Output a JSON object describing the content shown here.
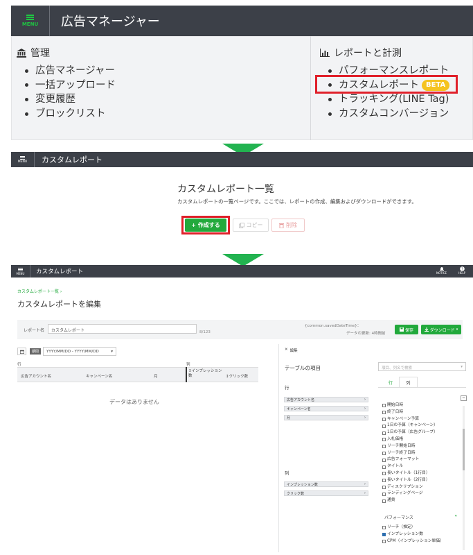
{
  "panel1": {
    "menu_label": "MENU",
    "title": "広告マネージャー",
    "admin": {
      "heading": "管理",
      "items": [
        "広告マネージャー",
        "一括アップロード",
        "変更履歴",
        "ブロックリスト"
      ]
    },
    "reports": {
      "heading": "レポートと計測",
      "items": [
        "パフォーマンスレポート",
        "カスタムレポート",
        "トラッキング(LINE Tag)",
        "カスタムコンバージョン"
      ],
      "beta_label": "BETA"
    }
  },
  "panel2": {
    "menu_label": "MENU",
    "header_title": "カスタムレポート",
    "page_title": "カスタムレポート一覧",
    "description": "カスタムレポートの一覧ページです。ここでは、レポートの作成、編集およびダウンロードができます。",
    "create_btn": "+ 作成する",
    "copy_btn": "コピー",
    "delete_btn": "削除"
  },
  "panel3": {
    "menu_label": "MENU",
    "header_title": "カスタムレポート",
    "notice_label": "NOTICE",
    "help_label": "HELP",
    "breadcrumb": "カスタムレポート一覧 ›",
    "page_title": "カスタムレポートを編集",
    "report_name_label": "レポート名",
    "report_name_value": "カスタムレポート",
    "char_count": "8/123",
    "saved_time": "{common.savedDateTime}：",
    "data_update": "データの更新: 4時間前",
    "save_btn": "保存",
    "download_btn": "ダウンロード",
    "period_label": "期間",
    "date_placeholder": "YYYY/MM/DD - YYYY/MM/DD",
    "rows_label": "行",
    "cols_label": "列",
    "table_cols": [
      "広告アカウント名",
      "キャンペーン名",
      "月",
      "インプレッション数",
      "クリック数"
    ],
    "no_data": "データはありません",
    "edit_label": "編集",
    "table_items_label": "テーブルの項目",
    "search_placeholder": "項目、列名で検索",
    "row_section": "行",
    "row_chips": [
      "広告アカウント名",
      "キャンペーン名",
      "月"
    ],
    "col_section": "列",
    "col_chips": [
      "インプレッション数",
      "クリック数"
    ],
    "tabs": [
      "行",
      "列"
    ],
    "checklist": [
      "開始日時",
      "終了日時",
      "キャンペーン予算",
      "1日の予算（キャンペーン）",
      "1日の予算（広告グループ）",
      "入札価格",
      "リーチ開始日時",
      "リーチ終了日時",
      "広告フォーマット",
      "タイトル",
      "長いタイトル（1行目）",
      "長いタイトル（2行目）",
      "ディスクリプション",
      "ランディングページ",
      "通貨"
    ],
    "perf_section": "パフォーマンス",
    "perf_items": [
      "リーチ（推定）",
      "インプレッション数",
      "CPM（インプレッション単価）"
    ]
  },
  "colors": {
    "header_bg": "#3c4048",
    "accent_green": "#1ec642",
    "button_green": "#22a93c",
    "highlight_red": "#e0202a",
    "beta_yellow": "#f5c320"
  }
}
